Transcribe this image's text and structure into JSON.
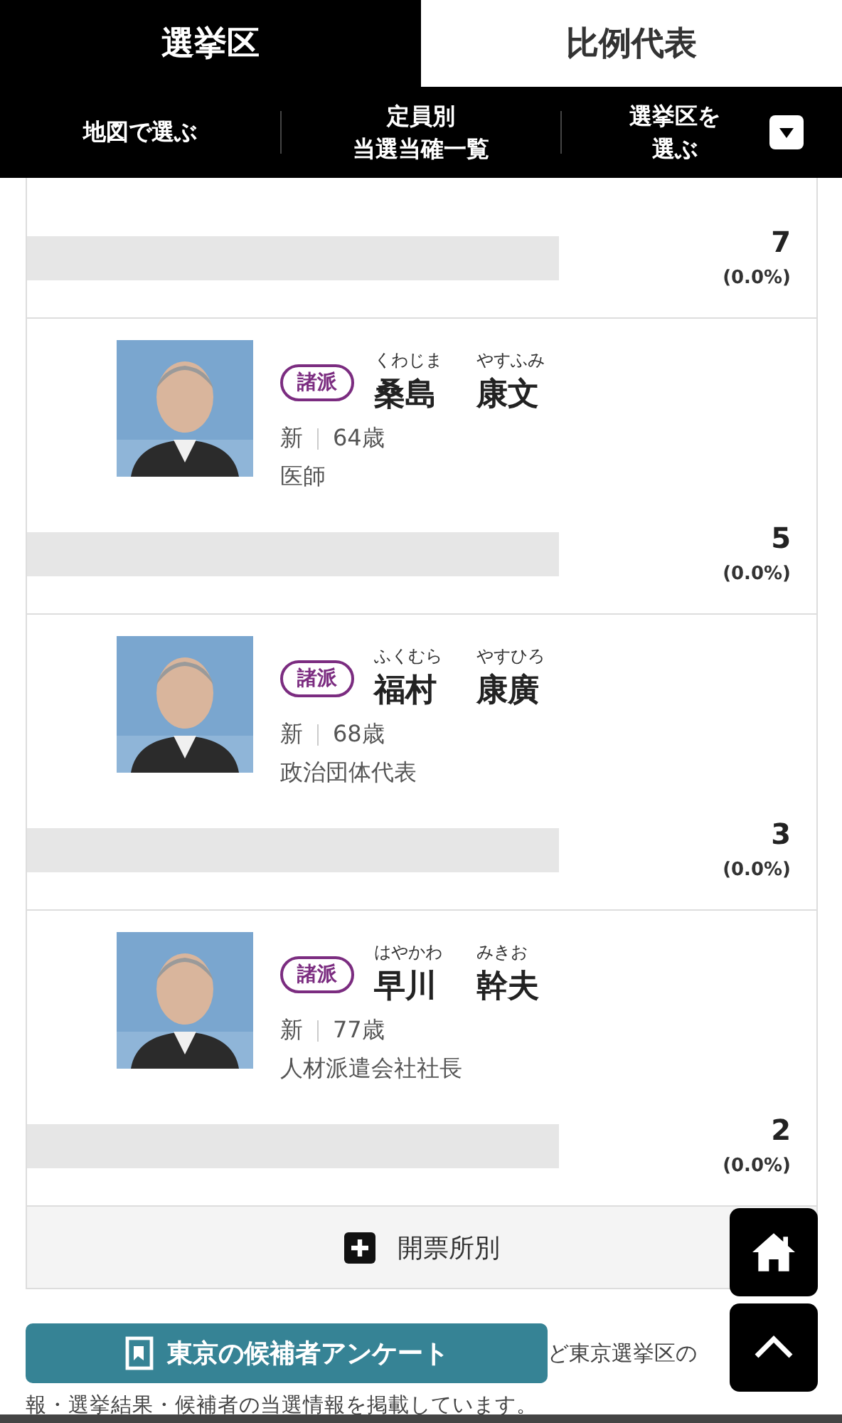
{
  "tabs": [
    {
      "label": "選挙区",
      "selected": true
    },
    {
      "label": "比例代表",
      "selected": false
    }
  ],
  "subnav": [
    {
      "lines": [
        "地図で選ぶ"
      ],
      "kind": "link"
    },
    {
      "lines": [
        "定員別",
        "当選当確一覧"
      ],
      "kind": "link"
    },
    {
      "lines": [
        "選挙区を",
        "選ぶ"
      ],
      "kind": "dropdown"
    }
  ],
  "partial_row": {
    "votes": "7",
    "percent": "(0.0%)"
  },
  "candidates": [
    {
      "party": "諸派",
      "furigana": [
        "くわじま",
        "やすふみ"
      ],
      "name": [
        "桑島",
        "康文"
      ],
      "status": "新",
      "age": "64歳",
      "occupation": "医師",
      "votes": "5",
      "percent": "(0.0%)"
    },
    {
      "party": "諸派",
      "furigana": [
        "ふくむら",
        "やすひろ"
      ],
      "name": [
        "福村",
        "康廣"
      ],
      "status": "新",
      "age": "68歳",
      "occupation": "政治団体代表",
      "votes": "3",
      "percent": "(0.0%)"
    },
    {
      "party": "諸派",
      "furigana": [
        "はやかわ",
        "みきお"
      ],
      "name": [
        "早川",
        "幹夫"
      ],
      "status": "新",
      "age": "77歳",
      "occupation": "人材派遣会社社長",
      "votes": "2",
      "percent": "(0.0%)"
    }
  ],
  "by_station": {
    "label": "開票所別",
    "expanded": false
  },
  "survey_button": "東京の候補者アンケート",
  "note": [
    "ど東京選挙区の",
    "報・選挙結果・候補者の当選情報を掲載しています。"
  ]
}
